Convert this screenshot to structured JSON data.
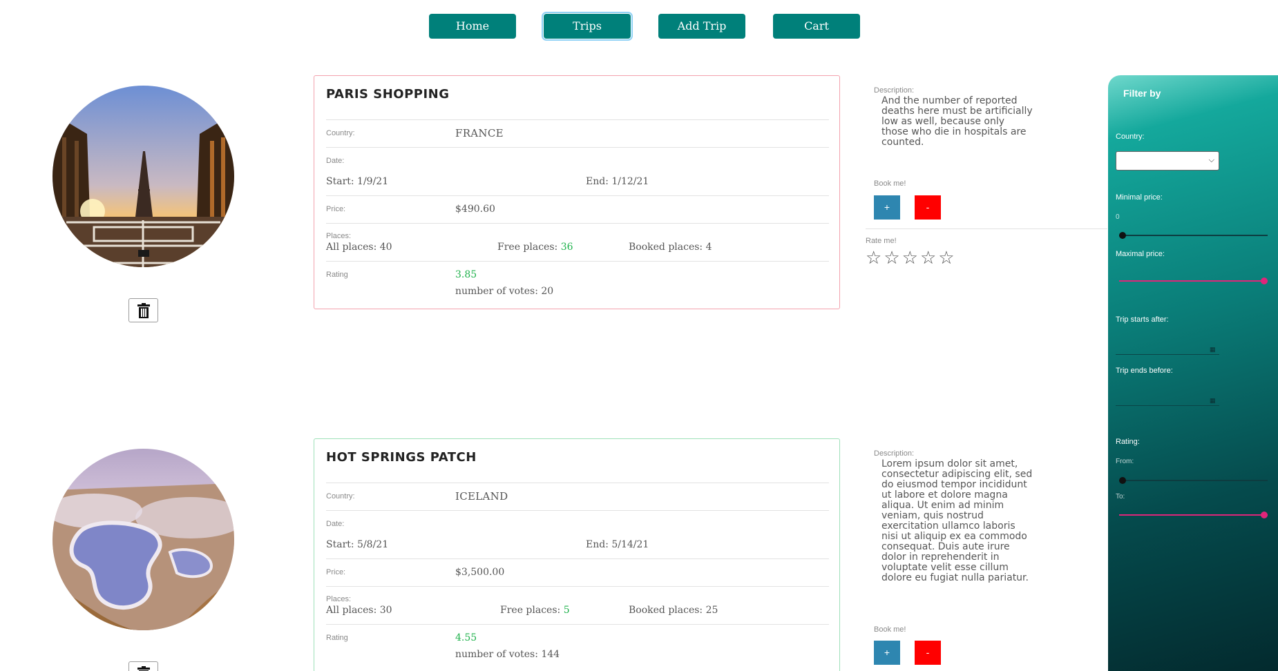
{
  "nav": {
    "home": "Home",
    "trips": "Trips",
    "add_trip": "Add Trip",
    "cart": "Cart"
  },
  "trips": [
    {
      "title": "PARIS SHOPPING",
      "country_label": "Country:",
      "country": "FRANCE",
      "date_label": "Date:",
      "start": "Start: 1/9/21",
      "end": "End: 1/12/21",
      "price_label": "Price:",
      "price": "$490.60",
      "places_label": "Places:",
      "all_places": "All places: 40",
      "free_places_label": "Free places:",
      "free_places": "36",
      "booked_places": "Booked places: 4",
      "rating_label": "Rating",
      "rating": "3.85",
      "votes": "number of votes: 20",
      "description_label": "Description:",
      "description": "And the number of reported deaths here must be artificially low as well, because only those who die in hospitals are counted.",
      "book_label": "Book me!",
      "plus": "+",
      "minus": "-",
      "border_color": "#f3a1ac",
      "image": "eiffel-tower-photo"
    },
    {
      "title": "HOT SPRINGS PATCH",
      "country_label": "Country:",
      "country": "ICELAND",
      "date_label": "Date:",
      "start": "Start: 5/8/21",
      "end": "End: 5/14/21",
      "price_label": "Price:",
      "price": "$3,500.00",
      "places_label": "Places:",
      "all_places": "All places: 30",
      "free_places_label": "Free places:",
      "free_places": "5",
      "booked_places": "Booked places: 25",
      "rating_label": "Rating",
      "rating": "4.55",
      "votes": "number of votes: 144",
      "description_label": "Description:",
      "description": "Lorem ipsum dolor sit amet, consectetur adipiscing elit, sed do eiusmod tempor incididunt ut labore et dolore magna aliqua. Ut enim ad minim veniam, quis nostrud exercitation ullamco laboris nisi ut aliquip ex ea commodo consequat. Duis aute irure dolor in reprehenderit in voluptate velit esse cillum dolore eu fugiat nulla pariatur.",
      "book_label": "Book me!",
      "plus": "+",
      "minus": "-",
      "border_color": "#9de0b8",
      "image": "hot-springs-photo"
    }
  ],
  "rate": {
    "label": "Rate me!",
    "stars": [
      "☆",
      "☆",
      "☆",
      "☆",
      "☆"
    ]
  },
  "filter": {
    "title": "Filter by",
    "country_label": "Country:",
    "country_value": "",
    "min_price_label": "Minimal price:",
    "min_price_value": "0",
    "min_price_level": 0,
    "max_price_label": "Maximal price:",
    "max_price_level": 1,
    "start_after_label": "Trip starts after:",
    "end_before_label": "Trip ends before:",
    "rating_label": "Rating:",
    "from_label": "From:",
    "rating_from_level": 0,
    "to_label": "To:",
    "rating_to_level": 1
  },
  "colors": {
    "accent": "#00807a",
    "plus_button": "#2e86b0",
    "minus_button": "#ff0000",
    "rating_green": "#1db14a",
    "slider_pink": "#e0257a"
  },
  "icons": {
    "delete": "trash-icon",
    "calendar": "calendar-icon",
    "dropdown": "chevron-down-icon"
  }
}
